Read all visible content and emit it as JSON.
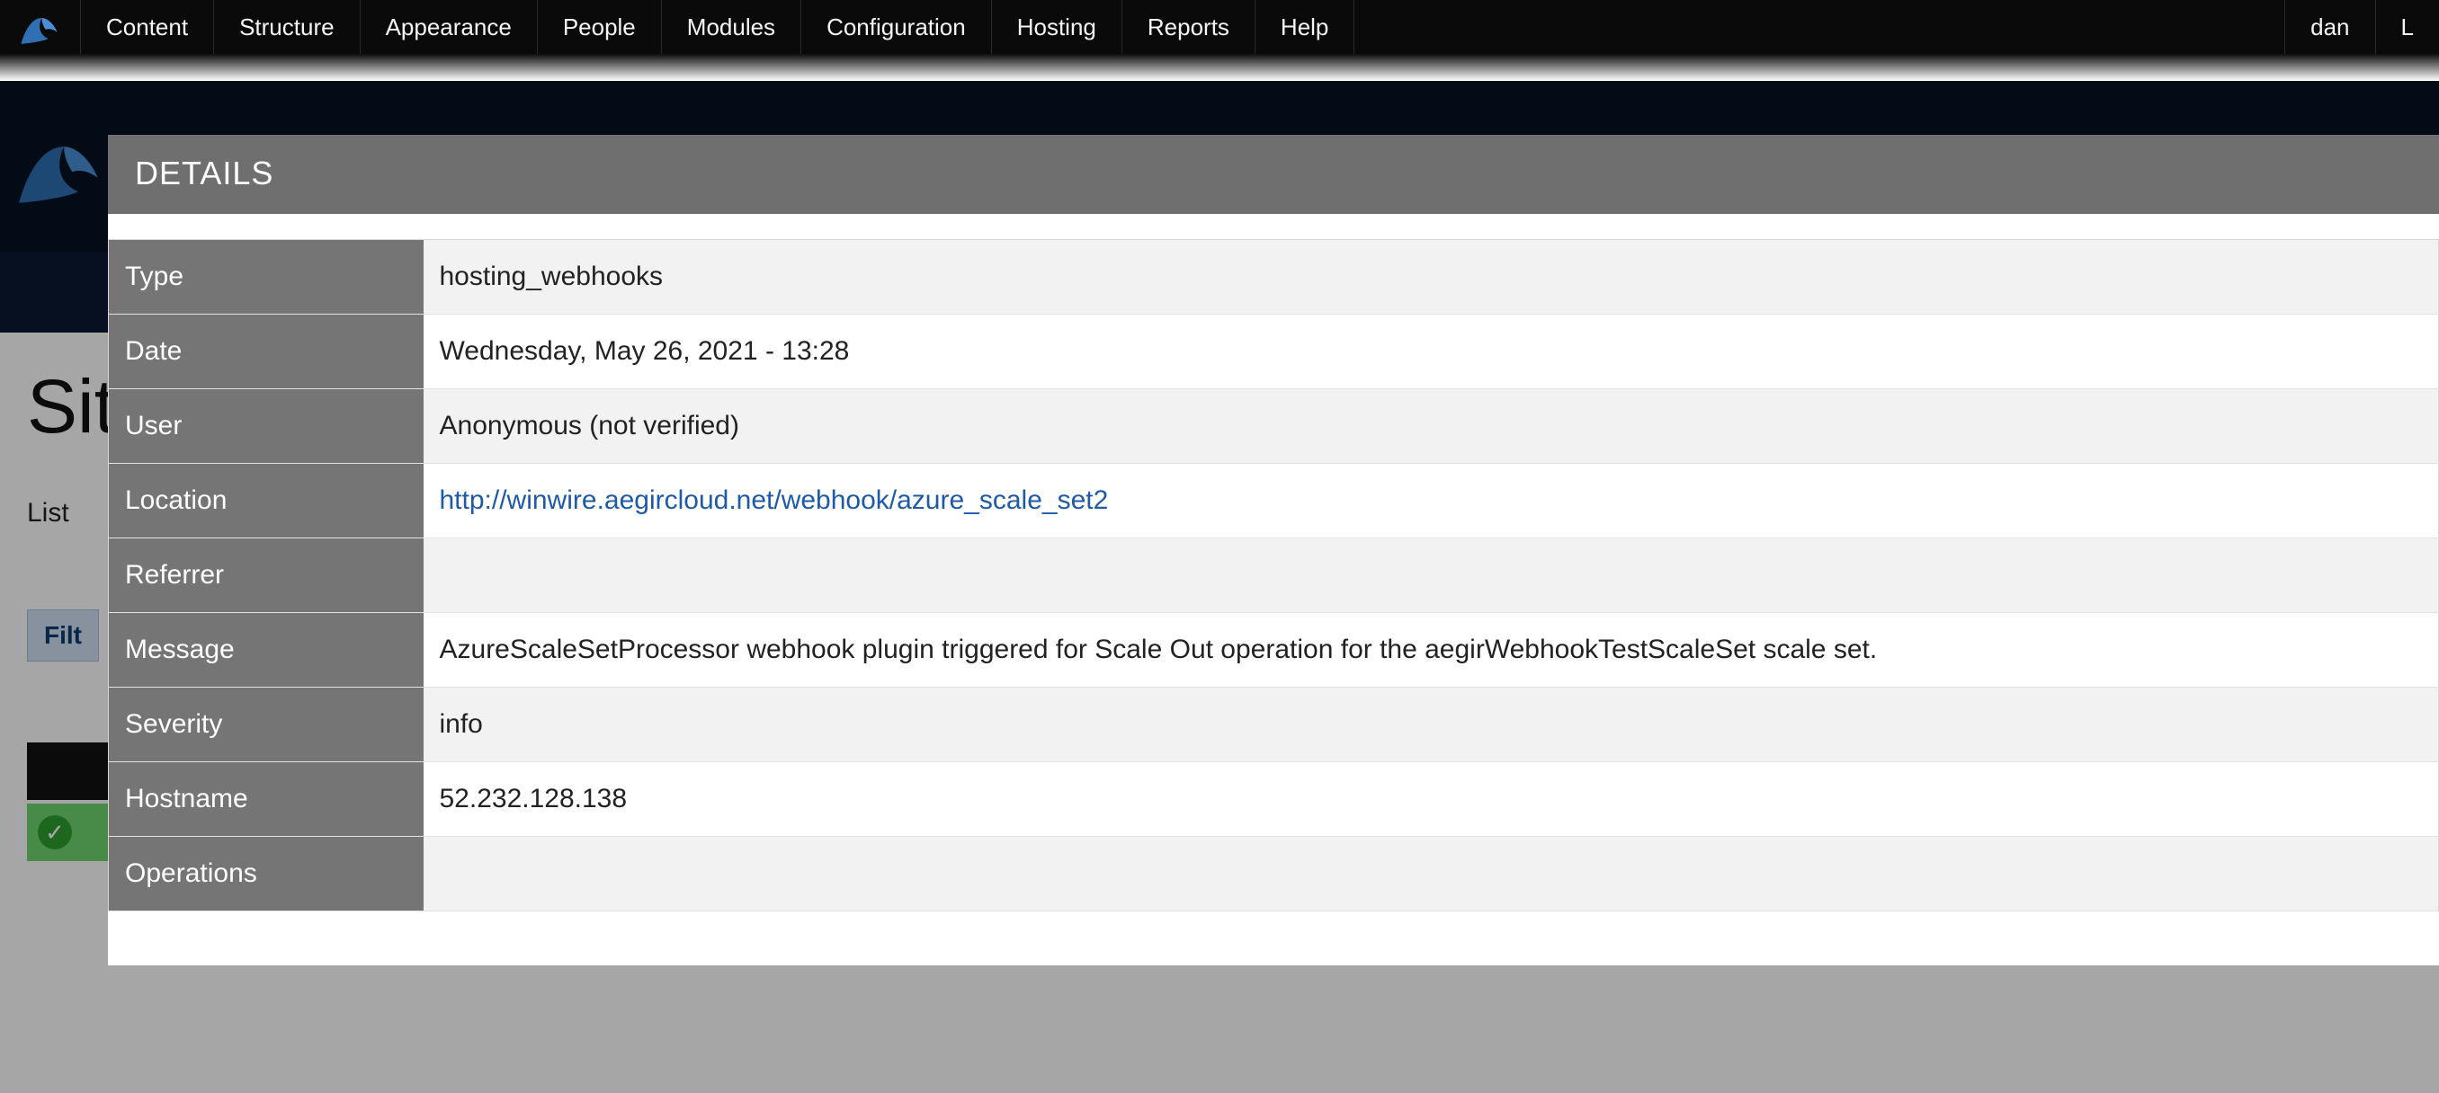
{
  "toolbar": {
    "items": [
      "Content",
      "Structure",
      "Appearance",
      "People",
      "Modules",
      "Configuration",
      "Hosting",
      "Reports",
      "Help"
    ],
    "user": "dan",
    "user_extra": "L"
  },
  "bg_page": {
    "title_fragment": "Sit",
    "list_label_fragment": "List",
    "filter_label_fragment": "Filt"
  },
  "modal": {
    "title": "DETAILS",
    "rows": [
      {
        "label": "Type",
        "value": "hosting_webhooks"
      },
      {
        "label": "Date",
        "value": "Wednesday, May 26, 2021 - 13:28"
      },
      {
        "label": "User",
        "value": "Anonymous (not verified)"
      },
      {
        "label": "Location",
        "value": "http://winwire.aegircloud.net/webhook/azure_scale_set2",
        "is_link": true
      },
      {
        "label": "Referrer",
        "value": ""
      },
      {
        "label": "Message",
        "value": "AzureScaleSetProcessor webhook plugin triggered for Scale Out operation for the aegirWebhookTestScaleSet scale set."
      },
      {
        "label": "Severity",
        "value": "info"
      },
      {
        "label": "Hostname",
        "value": "52.232.128.138"
      },
      {
        "label": "Operations",
        "value": ""
      }
    ]
  }
}
